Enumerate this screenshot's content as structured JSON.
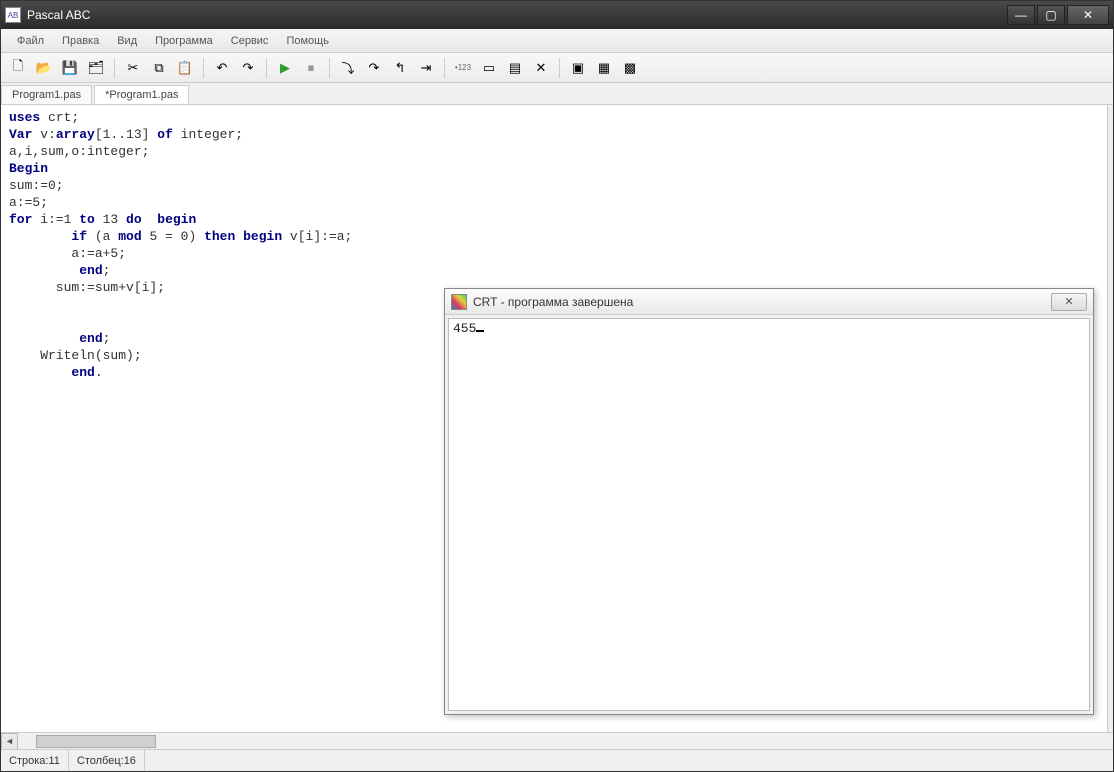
{
  "window": {
    "title": "Pascal ABC",
    "app_icon_text": "AB"
  },
  "menu": {
    "items": [
      "Файл",
      "Правка",
      "Вид",
      "Программа",
      "Сервис",
      "Помощь"
    ]
  },
  "toolbar": {
    "icons": [
      {
        "name": "new-icon",
        "glyph": "🗋"
      },
      {
        "name": "open-icon",
        "glyph": "📂"
      },
      {
        "name": "save-icon",
        "glyph": "💾"
      },
      {
        "name": "save-all-icon",
        "glyph": "🗂"
      },
      {
        "sep": true
      },
      {
        "name": "cut-icon",
        "glyph": "✂"
      },
      {
        "name": "copy-icon",
        "glyph": "⧉"
      },
      {
        "name": "paste-icon",
        "glyph": "📋"
      },
      {
        "sep": true
      },
      {
        "name": "undo-icon",
        "glyph": "↶"
      },
      {
        "name": "redo-icon",
        "glyph": "↷"
      },
      {
        "sep": true
      },
      {
        "name": "run-icon",
        "glyph": "▶"
      },
      {
        "name": "stop-icon",
        "glyph": "⏹"
      },
      {
        "sep": true
      },
      {
        "name": "step-into-icon",
        "glyph": "⤵"
      },
      {
        "name": "step-over-icon",
        "glyph": "↷"
      },
      {
        "name": "step-out-icon",
        "glyph": "↰"
      },
      {
        "name": "run-to-cursor-icon",
        "glyph": "⇥"
      },
      {
        "sep": true
      },
      {
        "name": "breakpoint-icon",
        "glyph": "•123"
      },
      {
        "name": "watch-icon",
        "glyph": "▭"
      },
      {
        "name": "locals-icon",
        "glyph": "▤"
      },
      {
        "name": "close-panel-icon",
        "glyph": "✕"
      },
      {
        "sep": true
      },
      {
        "name": "form-icon",
        "glyph": "▣"
      },
      {
        "name": "design-icon",
        "glyph": "▦"
      },
      {
        "name": "code-icon",
        "glyph": "▩"
      }
    ]
  },
  "tabs": {
    "items": [
      {
        "label": "Program1.pas",
        "active": false
      },
      {
        "label": "*Program1.pas",
        "active": true
      }
    ]
  },
  "code": {
    "lines": [
      {
        "t": [
          {
            "k": true,
            "s": "uses"
          },
          {
            "k": false,
            "s": " crt;"
          }
        ]
      },
      {
        "t": [
          {
            "k": true,
            "s": "Var"
          },
          {
            "k": false,
            "s": " v:"
          },
          {
            "k": true,
            "s": "array"
          },
          {
            "k": false,
            "s": "[1..13] "
          },
          {
            "k": true,
            "s": "of"
          },
          {
            "k": false,
            "s": " integer;"
          }
        ]
      },
      {
        "t": [
          {
            "k": false,
            "s": "a,i,sum,o:integer;"
          }
        ]
      },
      {
        "t": [
          {
            "k": true,
            "s": "Begin"
          }
        ]
      },
      {
        "t": [
          {
            "k": false,
            "s": "sum:=0;"
          }
        ]
      },
      {
        "t": [
          {
            "k": false,
            "s": "a:=5;"
          }
        ]
      },
      {
        "t": [
          {
            "k": true,
            "s": "for"
          },
          {
            "k": false,
            "s": " i:=1 "
          },
          {
            "k": true,
            "s": "to"
          },
          {
            "k": false,
            "s": " 13 "
          },
          {
            "k": true,
            "s": "do"
          },
          {
            "k": false,
            "s": "  "
          },
          {
            "k": true,
            "s": "begin"
          }
        ]
      },
      {
        "t": [
          {
            "k": false,
            "s": "        "
          },
          {
            "k": true,
            "s": "if"
          },
          {
            "k": false,
            "s": " (a "
          },
          {
            "k": true,
            "s": "mod"
          },
          {
            "k": false,
            "s": " 5 = 0) "
          },
          {
            "k": true,
            "s": "then"
          },
          {
            "k": false,
            "s": " "
          },
          {
            "k": true,
            "s": "begin"
          },
          {
            "k": false,
            "s": " v[i]:=a;"
          }
        ]
      },
      {
        "t": [
          {
            "k": false,
            "s": "        a:=a+5;"
          }
        ]
      },
      {
        "t": [
          {
            "k": false,
            "s": "         "
          },
          {
            "k": true,
            "s": "end"
          },
          {
            "k": false,
            "s": ";"
          }
        ]
      },
      {
        "t": [
          {
            "k": false,
            "s": "      sum:=sum+v[i];"
          }
        ]
      },
      {
        "t": [
          {
            "k": false,
            "s": ""
          }
        ]
      },
      {
        "t": [
          {
            "k": false,
            "s": ""
          }
        ]
      },
      {
        "t": [
          {
            "k": false,
            "s": "         "
          },
          {
            "k": true,
            "s": "end"
          },
          {
            "k": false,
            "s": ";"
          }
        ]
      },
      {
        "t": [
          {
            "k": false,
            "s": "    Writeln(sum);"
          }
        ]
      },
      {
        "t": [
          {
            "k": false,
            "s": "        "
          },
          {
            "k": true,
            "s": "end"
          },
          {
            "k": false,
            "s": "."
          }
        ]
      }
    ]
  },
  "crt": {
    "title": "CRT - программа завершена",
    "output": "455"
  },
  "status": {
    "line_label": "Строка: ",
    "line_value": "11",
    "col_label": "Столбец: ",
    "col_value": "16"
  }
}
